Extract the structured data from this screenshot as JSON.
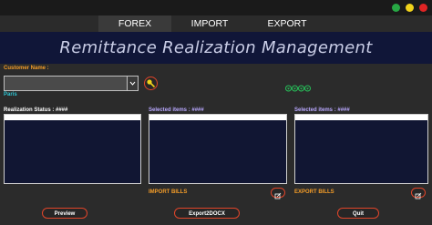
{
  "window": {
    "controls": [
      {
        "name": "green",
        "color": "#27a744"
      },
      {
        "name": "yellow",
        "color": "#f0d21b"
      },
      {
        "name": "red",
        "color": "#e02424"
      }
    ]
  },
  "tabs": [
    {
      "label": "FOREX",
      "active": true
    },
    {
      "label": "IMPORT",
      "active": false
    },
    {
      "label": "EXPORT",
      "active": false
    }
  ],
  "banner": {
    "title": "Remittance Realization Management"
  },
  "customer": {
    "label": "Customer Name :",
    "value": "",
    "sublabel": "Paris",
    "search_icon": "key-icon",
    "status_icons": [
      "circle-arrow-icon",
      "circle-arrow-icon",
      "circle-arrow-icon",
      "circle-arrow-icon"
    ]
  },
  "panels": {
    "realization": {
      "label": "Realization Status : ####"
    },
    "import": {
      "label": "Selected items : ####",
      "footer": "IMPORT BILLS"
    },
    "export": {
      "label": "Selected items : ####",
      "footer": "EXPORT BILLS"
    }
  },
  "buttons": {
    "preview": "Preview",
    "export2docx": "Export2DOCX",
    "quit": "Quit"
  },
  "colors": {
    "accent_orange": "#f39c28",
    "banner_bg": "#101638",
    "button_border": "#e0452a"
  }
}
